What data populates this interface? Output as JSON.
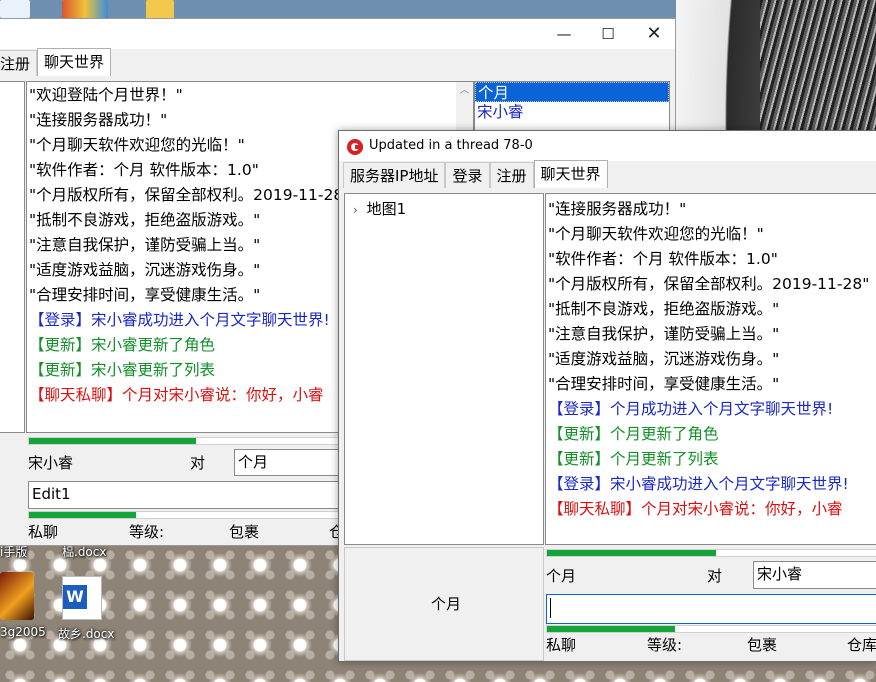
{
  "desktop": {
    "icons": [
      {
        "label": "榀.docx"
      },
      {
        "label": "3g2005"
      },
      {
        "label": "故乡.docx"
      }
    ],
    "partial_label": "i手版"
  },
  "win1": {
    "tabs": [
      "注册",
      "聊天世界"
    ],
    "messages": [
      {
        "text": "\"欢迎登陆个月世界！\"",
        "color": "black"
      },
      {
        "text": "\"连接服务器成功！\"",
        "color": "black"
      },
      {
        "text": "\"个月聊天软件欢迎您的光临！\"",
        "color": "black"
      },
      {
        "text": "\"软件作者：个月 软件版本：1.0\"",
        "color": "black"
      },
      {
        "text": "\"个月版权所有，保留全部权利。2019-11-28\"",
        "color": "black"
      },
      {
        "text": "\"抵制不良游戏，拒绝盗版游戏。\"",
        "color": "black"
      },
      {
        "text": "\"注意自我保护，谨防受骗上当。\"",
        "color": "black"
      },
      {
        "text": "\"适度游戏益脑，沉迷游戏伤身。\"",
        "color": "black"
      },
      {
        "text": "\"合理安排时间，享受健康生活。\"",
        "color": "black"
      },
      {
        "text": "【登录】宋小睿成功进入个月文字聊天世界!",
        "color": "blue"
      },
      {
        "text": "【更新】宋小睿更新了角色",
        "color": "green"
      },
      {
        "text": "【更新】宋小睿更新了列表",
        "color": "green"
      },
      {
        "text": "【聊天私聊】个月对宋小睿说：你好，小睿",
        "color": "red"
      }
    ],
    "users": [
      {
        "name": "个月",
        "selected": true
      },
      {
        "name": "宋小睿",
        "selected": false
      }
    ],
    "progress_top": 0.5,
    "progress_bottom": 0.34,
    "sender": "宋小睿",
    "to_label": "对",
    "target": "个月",
    "input_value": "Edit1",
    "status": {
      "chat": "私聊",
      "level": "等级:",
      "bag": "包裹",
      "warehouse": "仓"
    }
  },
  "win2": {
    "title": "Updated in a thread 78-0",
    "tabs": [
      "服务器IP地址",
      "登录",
      "注册",
      "聊天世界"
    ],
    "tree_root": "地图1",
    "messages": [
      {
        "text": "\"连接服务器成功！\"",
        "color": "black"
      },
      {
        "text": "\"个月聊天软件欢迎您的光临！\"",
        "color": "black"
      },
      {
        "text": "\"软件作者：个月 软件版本：1.0\"",
        "color": "black"
      },
      {
        "text": "\"个月版权所有，保留全部权利。2019-11-28\"",
        "color": "black"
      },
      {
        "text": "\"抵制不良游戏，拒绝盗版游戏。\"",
        "color": "black"
      },
      {
        "text": "\"注意自我保护，谨防受骗上当。\"",
        "color": "black"
      },
      {
        "text": "\"适度游戏益脑，沉迷游戏伤身。\"",
        "color": "black"
      },
      {
        "text": "\"合理安排时间，享受健康生活。\"",
        "color": "black"
      },
      {
        "text": "【登录】个月成功进入个月文字聊天世界!",
        "color": "blue"
      },
      {
        "text": "【更新】个月更新了角色",
        "color": "green"
      },
      {
        "text": "【更新】个月更新了列表",
        "color": "green"
      },
      {
        "text": "【登录】宋小睿成功进入个月文字聊天世界!",
        "color": "blue"
      },
      {
        "text": "【聊天私聊】个月对宋小睿说：你好，小睿",
        "color": "red"
      }
    ],
    "self_name": "个月",
    "progress_top": 0.5,
    "progress_bottom": 0.38,
    "sender": "个月",
    "to_label": "对",
    "target": "宋小睿",
    "input_value": "",
    "status": {
      "chat": "私聊",
      "level": "等级:",
      "bag": "包裹",
      "warehouse": "仓库"
    }
  },
  "colors": {
    "black": "#000000",
    "blue": "#1a28c8",
    "green": "#13902a",
    "red": "#dd1010",
    "progress": "#13a538"
  }
}
